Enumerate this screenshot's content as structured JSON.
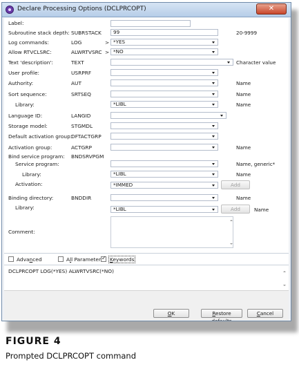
{
  "window": {
    "title": "Declare Processing Options (DCLPRCOPT)",
    "close_glyph": "✕"
  },
  "form": {
    "label": {
      "label": "Label:",
      "value": ""
    },
    "stack_depth": {
      "label": "Subroutine stack depth:",
      "keyword": "SUBRSTACK",
      "value": "99",
      "hint": "20-9999"
    },
    "log_commands": {
      "label": "Log commands:",
      "keyword": "LOG",
      "arrow": ">",
      "value": "*YES"
    },
    "allow_rtvclsrc": {
      "label": "Allow RTVCLSRC:",
      "keyword": "ALWRTVSRC",
      "arrow": ">",
      "value": "*NO"
    },
    "text": {
      "label": "Text 'description':",
      "keyword": "TEXT",
      "value": "",
      "hint": "Character value"
    },
    "user_profile": {
      "label": "User profile:",
      "keyword": "USRPRF",
      "value": ""
    },
    "authority": {
      "label": "Authority:",
      "keyword": "AUT",
      "value": "",
      "hint": "Name"
    },
    "sort_sequence": {
      "label": "Sort sequence:",
      "keyword": "SRTSEQ",
      "value": "",
      "hint": "Name"
    },
    "sort_library": {
      "label": "Library:",
      "value": "*LIBL",
      "hint": "Name"
    },
    "language_id": {
      "label": "Language ID:",
      "keyword": "LANGID",
      "value": ""
    },
    "storage_model": {
      "label": "Storage model:",
      "keyword": "STGMDL",
      "value": ""
    },
    "dft_act_grp": {
      "label": "Default activation group:",
      "keyword": "DFTACTGRP",
      "value": ""
    },
    "act_grp": {
      "label": "Activation group:",
      "keyword": "ACTGRP",
      "value": "",
      "hint": "Name"
    },
    "bind_srvpgm": {
      "label": "Bind service program:",
      "keyword": "BNDSRVPGM"
    },
    "service_program": {
      "label": "Service program:",
      "value": "",
      "hint": "Name, generic*"
    },
    "srvpgm_library": {
      "label": "Library:",
      "value": "*LIBL",
      "hint": "Name"
    },
    "activation": {
      "label": "Activation:",
      "value": "*IMMED",
      "add_label": "Add"
    },
    "binding_dir": {
      "label": "Binding directory:",
      "keyword": "BNDDIR",
      "value": "",
      "hint": "Name"
    },
    "bnddir_library": {
      "label": "Library:",
      "value": "*LIBL",
      "add_label": "Add",
      "hint": "Name"
    },
    "comment": {
      "label": "Comment:",
      "value": ""
    }
  },
  "options": {
    "advanced": {
      "label_pre": "Adva",
      "label_acc": "n",
      "label_post": "ced",
      "checked": false
    },
    "all_parameters": {
      "label_pre": "A",
      "label_acc": "l",
      "label_post": "l Parameters",
      "checked": false
    },
    "keywords": {
      "label_pre": "",
      "label_acc": "K",
      "label_post": "eywords",
      "checked": true
    }
  },
  "command_preview": "DCLPRCOPT LOG(*YES) ALWRTVSRC(*NO)",
  "buttons": {
    "ok": {
      "pre": "",
      "acc": "O",
      "post": "K"
    },
    "restore": {
      "pre": "",
      "acc": "R",
      "post": "estore defaults"
    },
    "cancel": {
      "pre": "",
      "acc": "C",
      "post": "ancel"
    }
  },
  "figure": {
    "title": "FIGURE 4",
    "caption": "Prompted DCLPRCOPT command"
  },
  "colors": {
    "title_gradient_top": "#d6e4f4",
    "close_button": "#c8462b",
    "field_border": "#b3bccb"
  }
}
